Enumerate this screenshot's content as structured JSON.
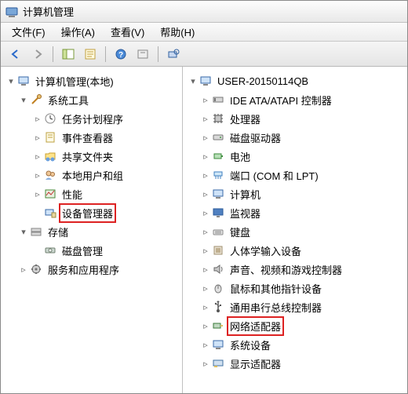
{
  "window": {
    "title": "计算机管理"
  },
  "menu": {
    "file": "文件(F)",
    "action": "操作(A)",
    "view": "查看(V)",
    "help": "帮助(H)"
  },
  "left_tree": {
    "root": "计算机管理(本地)",
    "system_tools": "系统工具",
    "task_scheduler": "任务计划程序",
    "event_viewer": "事件查看器",
    "shared_folders": "共享文件夹",
    "local_users": "本地用户和组",
    "performance": "性能",
    "device_manager": "设备管理器",
    "storage": "存储",
    "disk_mgmt": "磁盘管理",
    "services_apps": "服务和应用程序"
  },
  "right_tree": {
    "root": "USER-20150114QB",
    "ide": "IDE ATA/ATAPI 控制器",
    "cpu": "处理器",
    "disk_drives": "磁盘驱动器",
    "battery": "电池",
    "ports": "端口 (COM 和 LPT)",
    "computer": "计算机",
    "monitor": "监视器",
    "keyboard": "键盘",
    "hid": "人体学输入设备",
    "sound": "声音、视频和游戏控制器",
    "mouse": "鼠标和其他指针设备",
    "usb": "通用串行总线控制器",
    "network": "网络适配器",
    "system_devices": "系统设备",
    "display": "显示适配器"
  },
  "highlights": {
    "left": "device_manager",
    "right": "network"
  }
}
